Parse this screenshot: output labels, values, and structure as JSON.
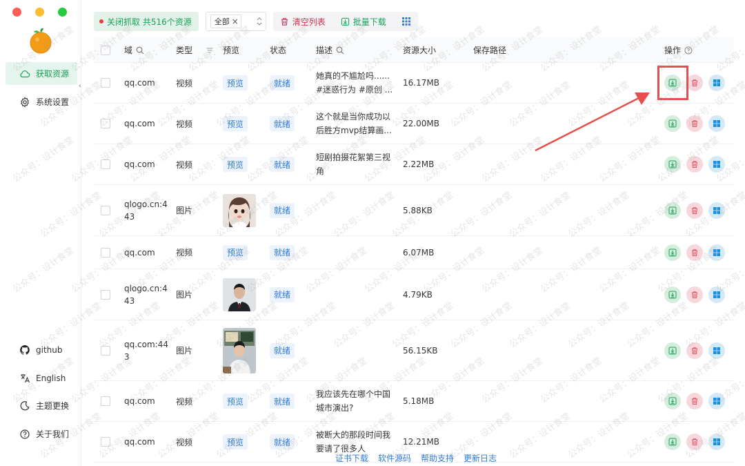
{
  "colors": {
    "brand": "#18a058",
    "danger": "#d03050",
    "link": "#2f7bd6"
  },
  "sidebar": {
    "nav": [
      {
        "label": "获取资源",
        "icon": "cloud-icon",
        "active": true
      },
      {
        "label": "系统设置",
        "icon": "gear-icon",
        "active": false
      }
    ],
    "bottom": [
      {
        "label": "github",
        "icon": "github-icon"
      },
      {
        "label": "English",
        "icon": "translate-icon"
      },
      {
        "label": "主题更换",
        "icon": "moon-icon"
      },
      {
        "label": "关于我们",
        "icon": "help-circle-icon"
      }
    ]
  },
  "toolbar": {
    "capture_label": "关闭抓取 共516个资源",
    "filter_tag": "全部",
    "clear_label": "清空列表",
    "batch_label": "批量下载"
  },
  "table": {
    "headers": {
      "domain": "域",
      "type": "类型",
      "preview": "预览",
      "status": "状态",
      "desc": "描述",
      "size": "资源大小",
      "path": "保存路径",
      "actions": "操作"
    },
    "rows": [
      {
        "domain": "qq.com",
        "type": "视频",
        "preview": "预览",
        "status": "就绪",
        "desc": "她真的不尴尬吗......#迷惑行为 #原创 ...",
        "size": "16.17MB"
      },
      {
        "domain": "qq.com",
        "type": "视频",
        "preview": "预览",
        "status": "就绪",
        "desc": "这个就是当你成功以后胜方mvp结算画...",
        "size": "22.00MB"
      },
      {
        "domain": "qq.com",
        "type": "视频",
        "preview": "预览",
        "status": "就绪",
        "desc": "短剧拍摄花絮第三视角",
        "size": "2.22MB"
      },
      {
        "domain": "qlogo.cn:443",
        "type": "图片",
        "preview": "",
        "status": "就绪",
        "desc": "",
        "size": "5.88KB",
        "thumb": "girl"
      },
      {
        "domain": "qq.com",
        "type": "视频",
        "preview": "预览",
        "status": "就绪",
        "desc": "",
        "size": "6.07MB"
      },
      {
        "domain": "qlogo.cn:443",
        "type": "图片",
        "preview": "",
        "status": "就绪",
        "desc": "",
        "size": "4.79KB",
        "thumb": "suit"
      },
      {
        "domain": "qq.com:443",
        "type": "图片",
        "preview": "",
        "status": "就绪",
        "desc": "",
        "size": "56.15KB",
        "thumb": "room"
      },
      {
        "domain": "qq.com",
        "type": "视频",
        "preview": "预览",
        "status": "就绪",
        "desc": "我应该先在哪个中国城市演出?",
        "size": "5.18MB"
      },
      {
        "domain": "qq.com",
        "type": "视频",
        "preview": "预览",
        "status": "就绪",
        "desc": "被断大的那段时间我要请了很多人",
        "size": "12.21MB"
      }
    ]
  },
  "footer": {
    "links": [
      "证书下载",
      "软件源码",
      "帮助支持",
      "更新日志"
    ]
  },
  "watermark": "公众号：设计食堂"
}
